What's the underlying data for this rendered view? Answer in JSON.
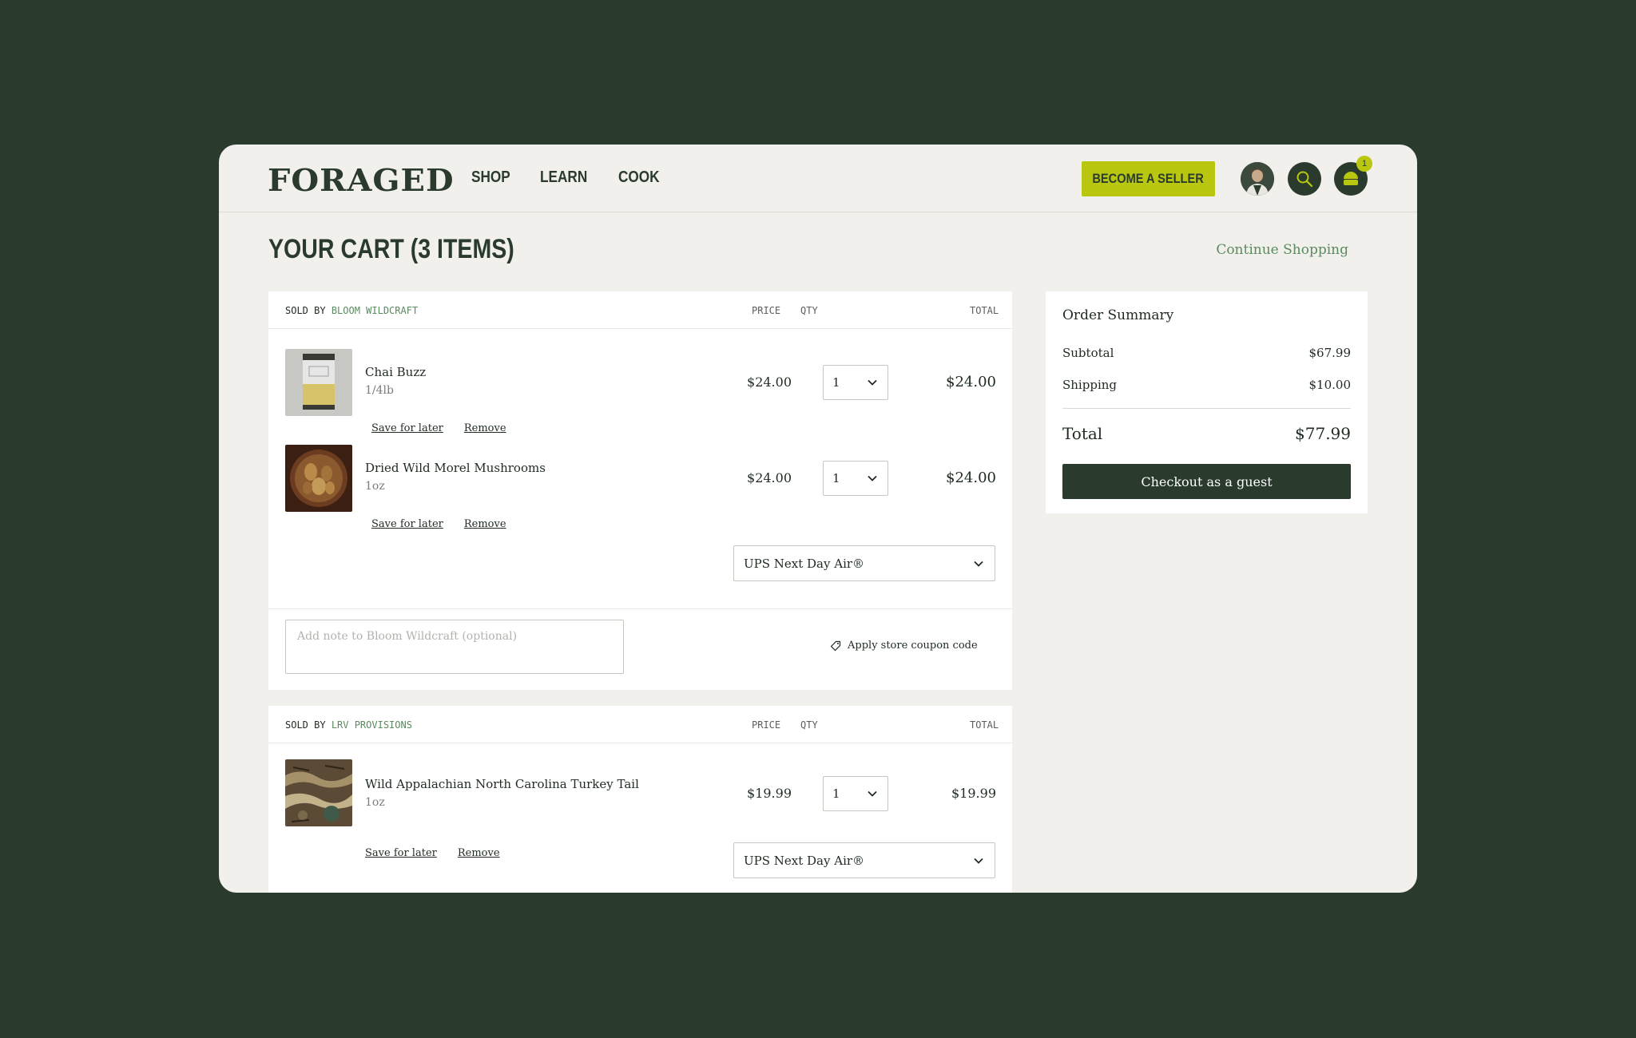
{
  "brand": {
    "logo": "FORAGED"
  },
  "nav": {
    "items": [
      {
        "label": "SHOP"
      },
      {
        "label": "LEARN"
      },
      {
        "label": "COOK"
      }
    ]
  },
  "header": {
    "seller_button": "BECOME A SELLER",
    "cart_count": "1"
  },
  "page": {
    "title": "YOUR CART (3 ITEMS)",
    "continue_link": "Continue Shopping"
  },
  "columns": {
    "price": "PRICE",
    "qty": "QTY",
    "total": "TOTAL"
  },
  "links": {
    "save_for_later": "Save for later",
    "remove": "Remove"
  },
  "sellers": [
    {
      "sold_by_prefix": "SOLD BY",
      "name": "BLOOM WILDCRAFT",
      "items": [
        {
          "name": "Chai Buzz",
          "variant": "1/4lb",
          "price": "$24.00",
          "qty": "1",
          "total": "$24.00"
        },
        {
          "name": "Dried Wild Morel Mushrooms",
          "variant": "1oz",
          "price": "$24.00",
          "qty": "1",
          "total": "$24.00"
        }
      ],
      "shipping": "UPS Next Day Air®",
      "note_placeholder": "Add note to Bloom Wildcraft (optional)",
      "coupon": "Apply store coupon code"
    },
    {
      "sold_by_prefix": "SOLD BY",
      "name": "LRV PROVISIONS",
      "items": [
        {
          "name": "Wild Appalachian North Carolina Turkey Tail",
          "variant": "1oz",
          "price": "$19.99",
          "qty": "1",
          "total": "$19.99"
        }
      ],
      "shipping": "UPS Next Day Air®"
    }
  ],
  "summary": {
    "title": "Order Summary",
    "subtotal_label": "Subtotal",
    "subtotal": "$67.99",
    "shipping_label": "Shipping",
    "shipping": "$10.00",
    "total_label": "Total",
    "total": "$77.99",
    "checkout_button": "Checkout as a guest"
  },
  "colors": {
    "background": "#2a3b2d",
    "accent": "#b9c710",
    "link": "#5a8a5e",
    "surface": "#f2f0ed"
  }
}
